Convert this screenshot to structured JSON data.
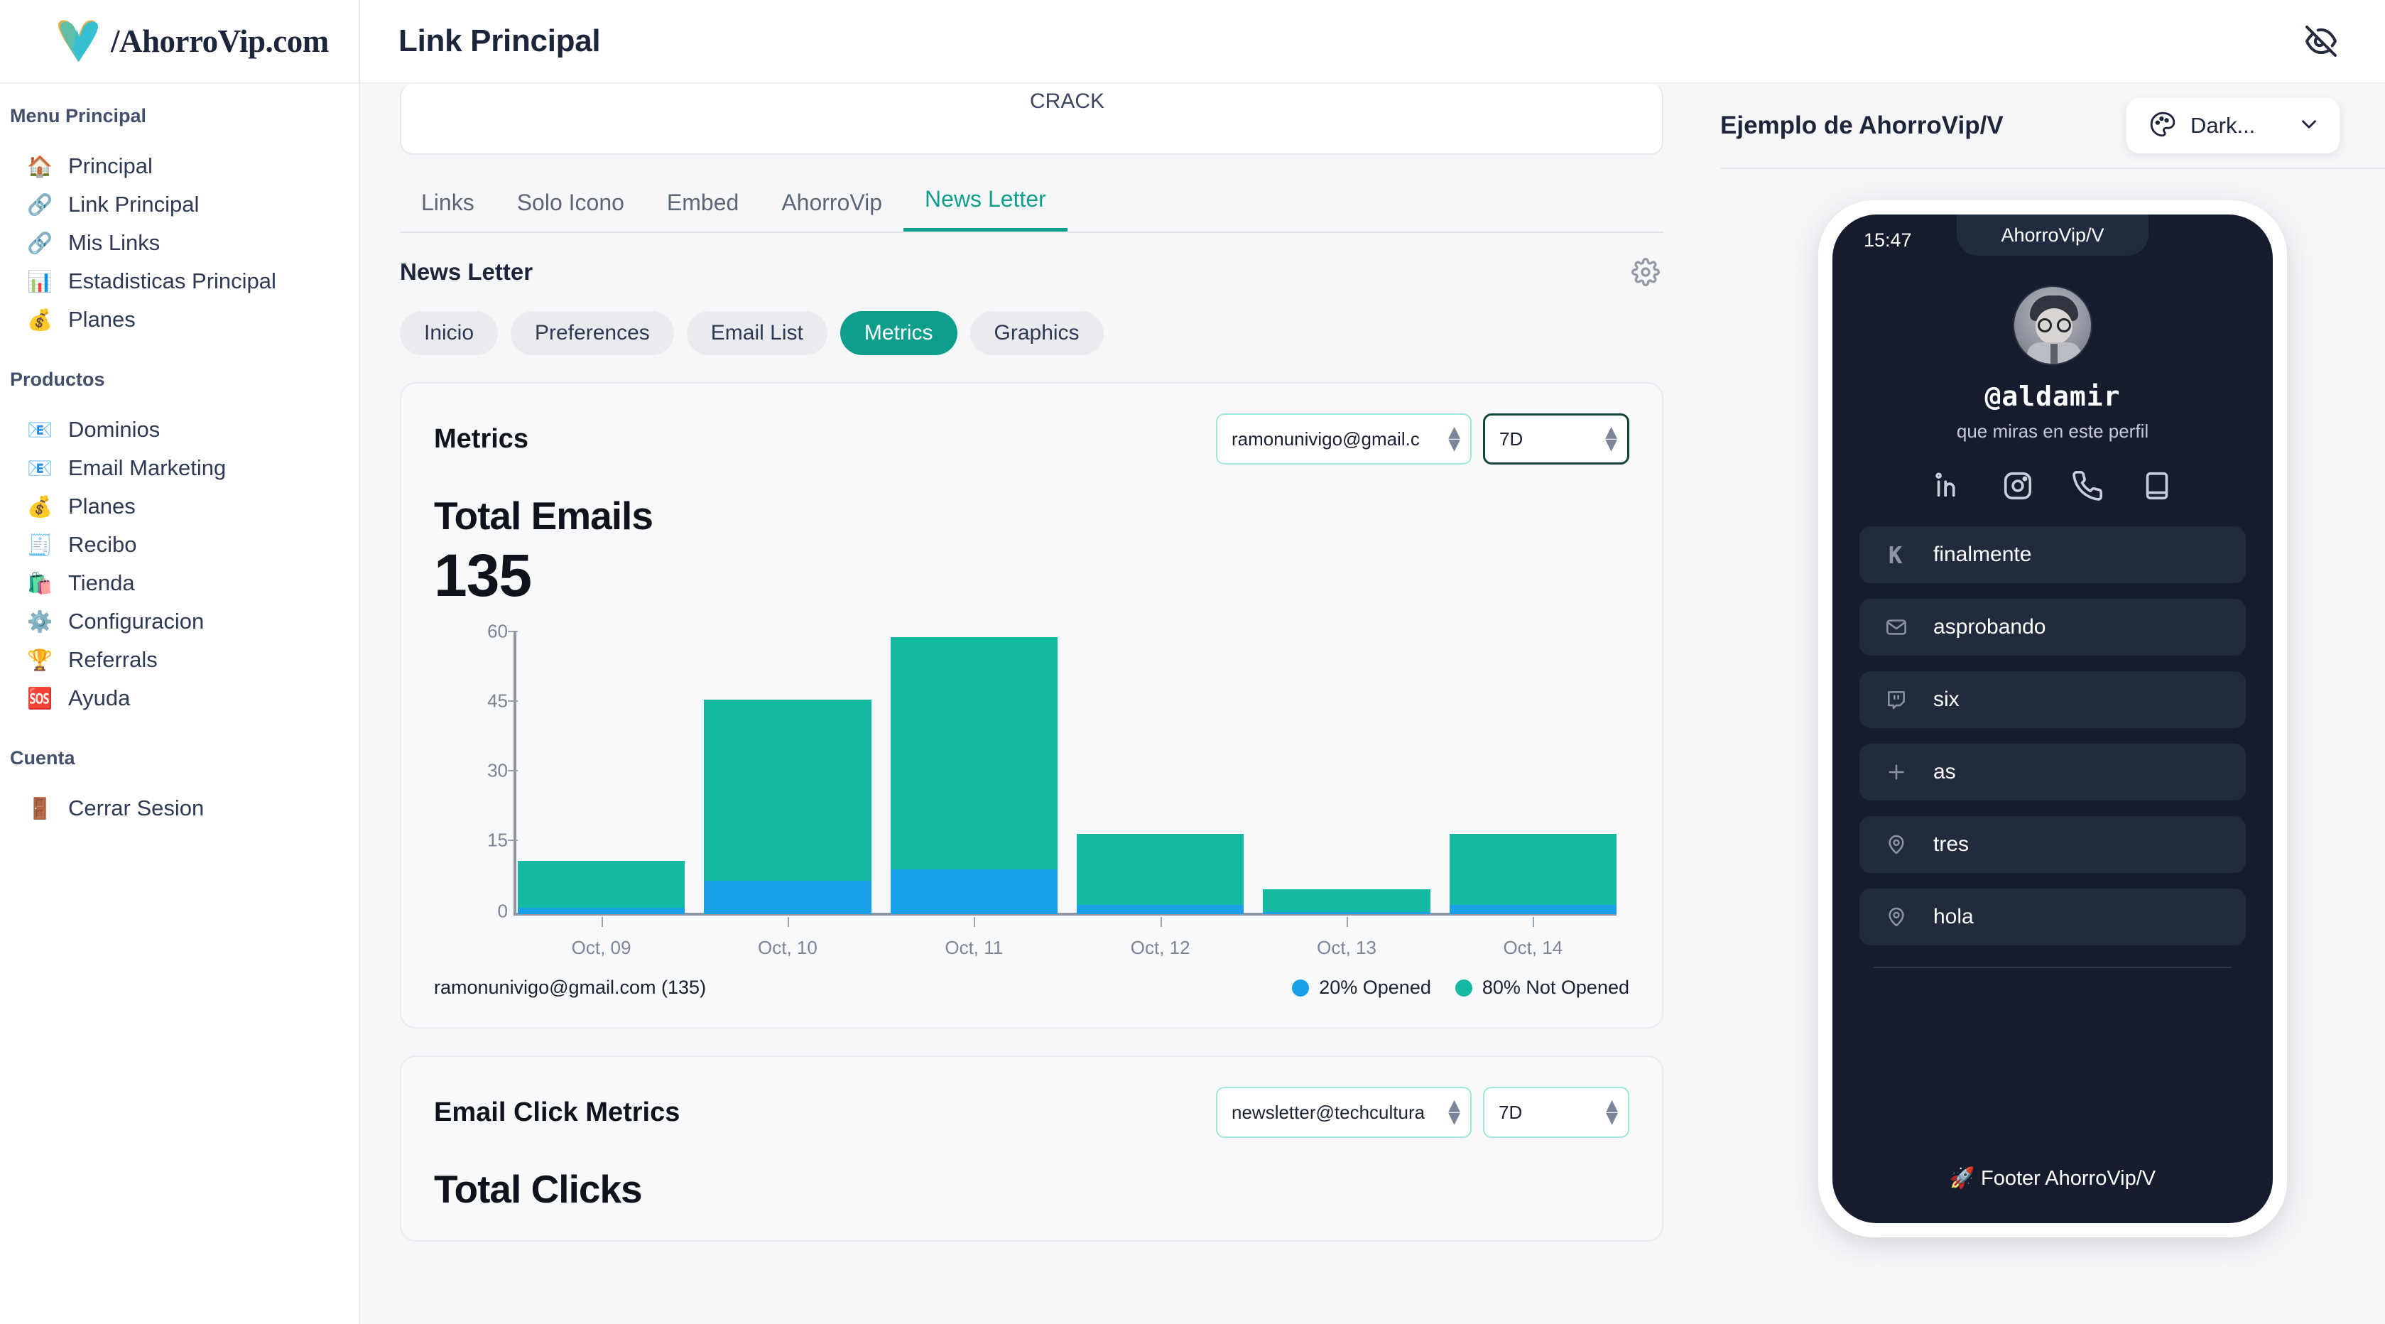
{
  "brand": {
    "name": "/AhorroVip.com",
    "logo_icon": "heart-v-logo"
  },
  "sidebar": {
    "groups": [
      {
        "title": "Menu Principal",
        "items": [
          {
            "label": "Principal",
            "icon": "🏠"
          },
          {
            "label": "Link Principal",
            "icon": "🔗"
          },
          {
            "label": "Mis Links",
            "icon": "🔗"
          },
          {
            "label": "Estadisticas Principal",
            "icon": "📊"
          },
          {
            "label": "Planes",
            "icon": "💰"
          }
        ]
      },
      {
        "title": "Productos",
        "items": [
          {
            "label": "Dominios",
            "icon": "📧"
          },
          {
            "label": "Email Marketing",
            "icon": "📧"
          },
          {
            "label": "Planes",
            "icon": "💰"
          },
          {
            "label": "Recibo",
            "icon": "🧾"
          },
          {
            "label": "Tienda",
            "icon": "🛍️"
          },
          {
            "label": "Configuracion",
            "icon": "⚙️"
          },
          {
            "label": "Referrals",
            "icon": "🏆"
          },
          {
            "label": "Ayuda",
            "icon": "🆘"
          }
        ]
      },
      {
        "title": "Cuenta",
        "items": [
          {
            "label": "Cerrar Sesion",
            "icon": "🚪"
          }
        ]
      }
    ]
  },
  "topbar": {
    "title": "Link Principal",
    "eye_off_icon": "eye-off-icon"
  },
  "editor": {
    "crack_text": "CRACK"
  },
  "tabs": [
    {
      "label": "Links",
      "active": false
    },
    {
      "label": "Solo Icono",
      "active": false
    },
    {
      "label": "Embed",
      "active": false
    },
    {
      "label": "AhorroVip",
      "active": false
    },
    {
      "label": "News Letter",
      "active": true
    }
  ],
  "newsletter": {
    "section_title": "News Letter",
    "gear_icon": "gear-icon",
    "pills": [
      {
        "label": "Inicio",
        "active": false
      },
      {
        "label": "Preferences",
        "active": false
      },
      {
        "label": "Email List",
        "active": false
      },
      {
        "label": "Metrics",
        "active": true
      },
      {
        "label": "Graphics",
        "active": false
      }
    ]
  },
  "metrics_card": {
    "title": "Metrics",
    "email_select": {
      "value": "ramonunivigo@gmail.c",
      "icon": "updown-arrows-icon"
    },
    "range_select": {
      "value": "7D",
      "icon": "updown-arrows-icon"
    },
    "kpi_label": "Total Emails",
    "kpi_value": "135",
    "footer_text": "ramonunivigo@gmail.com (135)",
    "legend": [
      {
        "label": "20% Opened",
        "color": "#1aa0e8"
      },
      {
        "label": "80% Not Opened",
        "color": "#13b9a0"
      }
    ]
  },
  "chart_data": {
    "type": "bar",
    "stacked": true,
    "title": "Total Emails",
    "xlabel": "",
    "ylabel": "",
    "ylim": [
      0,
      63
    ],
    "yticks": [
      0,
      15,
      30,
      45,
      60
    ],
    "grid": false,
    "legend_position": "bottom-right",
    "categories": [
      "Oct, 09",
      "Oct, 10",
      "Oct, 11",
      "Oct, 12",
      "Oct, 13",
      "Oct, 14"
    ],
    "series": [
      {
        "name": "20% Opened",
        "color": "#1aa0e8",
        "values": [
          1.5,
          7.5,
          10,
          2,
          0.5,
          2
        ]
      },
      {
        "name": "80% Not Opened",
        "color": "#13b9a0",
        "values": [
          10.5,
          40.5,
          52,
          16,
          5,
          16
        ]
      }
    ],
    "totals": [
      12,
      48,
      62,
      18,
      5.5,
      18
    ]
  },
  "click_card": {
    "title": "Email Click Metrics",
    "email_select": {
      "value": "newsletter@techcultura",
      "icon": "updown-arrows-icon"
    },
    "range_select": {
      "value": "7D",
      "icon": "updown-arrows-icon"
    },
    "kpi_label": "Total Clicks"
  },
  "preview": {
    "title": "Ejemplo de AhorroVip/V",
    "theme_button": {
      "label": "Dark...",
      "palette_icon": "palette-icon",
      "chevron_icon": "chevron-down-icon"
    },
    "phone": {
      "status_time": "15:47",
      "notch_text": "AhorroVip/V",
      "avatar_icon": "avatar",
      "handle": "@aldamir",
      "bio": "que miras en este perfil",
      "socials": [
        {
          "name": "linkedin-icon"
        },
        {
          "name": "instagram-icon"
        },
        {
          "name": "phone-icon"
        },
        {
          "name": "book-icon"
        }
      ],
      "links": [
        {
          "label": "finalmente",
          "icon": "kickstarter-icon"
        },
        {
          "label": "asprobando",
          "icon": "mail-icon"
        },
        {
          "label": "six",
          "icon": "twitch-icon"
        },
        {
          "label": "as",
          "icon": "plus-icon"
        },
        {
          "label": "tres",
          "icon": "map-pin-icon"
        },
        {
          "label": "hola",
          "icon": "map-pin-icon"
        }
      ],
      "footer": "🚀 Footer AhorroVip/V"
    }
  },
  "colors": {
    "accent_teal": "#0f9e8b",
    "chart_teal": "#13b9a0",
    "chart_blue": "#1aa0e8",
    "dark_navy": "#141c2e"
  }
}
